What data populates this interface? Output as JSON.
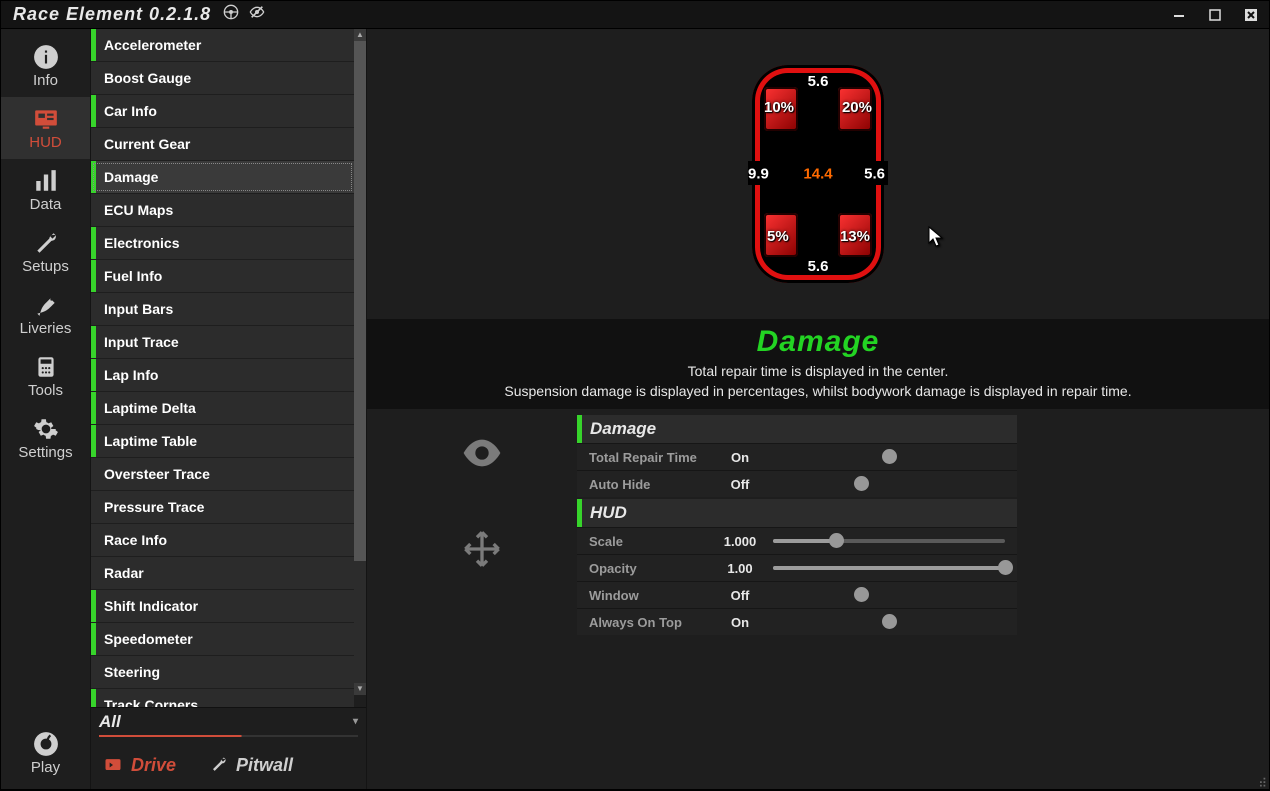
{
  "title": "Race Element 0.2.1.8",
  "nav": [
    {
      "id": "info",
      "label": "Info"
    },
    {
      "id": "hud",
      "label": "HUD"
    },
    {
      "id": "data",
      "label": "Data"
    },
    {
      "id": "setups",
      "label": "Setups"
    },
    {
      "id": "liveries",
      "label": "Liveries"
    },
    {
      "id": "tools",
      "label": "Tools"
    },
    {
      "id": "settings",
      "label": "Settings"
    }
  ],
  "nav_active": "HUD",
  "play": "Play",
  "hud_items": [
    {
      "label": "Accelerometer",
      "enabled": true
    },
    {
      "label": "Boost Gauge",
      "enabled": false
    },
    {
      "label": "Car Info",
      "enabled": true
    },
    {
      "label": "Current Gear",
      "enabled": false
    },
    {
      "label": "Damage",
      "enabled": true,
      "selected": true
    },
    {
      "label": "ECU Maps",
      "enabled": false
    },
    {
      "label": "Electronics",
      "enabled": true
    },
    {
      "label": "Fuel Info",
      "enabled": true
    },
    {
      "label": "Input Bars",
      "enabled": false
    },
    {
      "label": "Input Trace",
      "enabled": true
    },
    {
      "label": "Lap Info",
      "enabled": true
    },
    {
      "label": "Laptime Delta",
      "enabled": true
    },
    {
      "label": "Laptime Table",
      "enabled": true
    },
    {
      "label": "Oversteer Trace",
      "enabled": false
    },
    {
      "label": "Pressure Trace",
      "enabled": false
    },
    {
      "label": "Race Info",
      "enabled": false
    },
    {
      "label": "Radar",
      "enabled": false
    },
    {
      "label": "Shift Indicator",
      "enabled": true
    },
    {
      "label": "Speedometer",
      "enabled": true
    },
    {
      "label": "Steering",
      "enabled": false
    },
    {
      "label": "Track Corners",
      "enabled": true
    }
  ],
  "filter": {
    "label": "All"
  },
  "modes": {
    "drive": "Drive",
    "pitwall": "Pitwall"
  },
  "mode_active": "Drive",
  "overlay": {
    "title": "Damage",
    "desc1": "Total repair time is displayed in the center.",
    "desc2": "Suspension damage is displayed in percentages, whilst bodywork damage is displayed in repair time."
  },
  "damage_values": {
    "top": "5.6",
    "bottom": "5.6",
    "left": "9.9",
    "right": "5.6",
    "center": "14.4",
    "fl": "10%",
    "fr": "20%",
    "rl": "5%",
    "rr": "13%"
  },
  "groups": [
    {
      "name": "Damage",
      "props": [
        {
          "name": "Total Repair Time",
          "value": "On",
          "type": "toggle",
          "state": "on"
        },
        {
          "name": "Auto Hide",
          "value": "Off",
          "type": "toggle",
          "state": "off"
        }
      ]
    },
    {
      "name": "HUD",
      "props": [
        {
          "name": "Scale",
          "value": "1.000",
          "type": "slider",
          "fill": 0.27
        },
        {
          "name": "Opacity",
          "value": "1.00",
          "type": "slider",
          "fill": 1.0
        },
        {
          "name": "Window",
          "value": "Off",
          "type": "toggle",
          "state": "off"
        },
        {
          "name": "Always On Top",
          "value": "On",
          "type": "toggle",
          "state": "on"
        }
      ]
    }
  ]
}
